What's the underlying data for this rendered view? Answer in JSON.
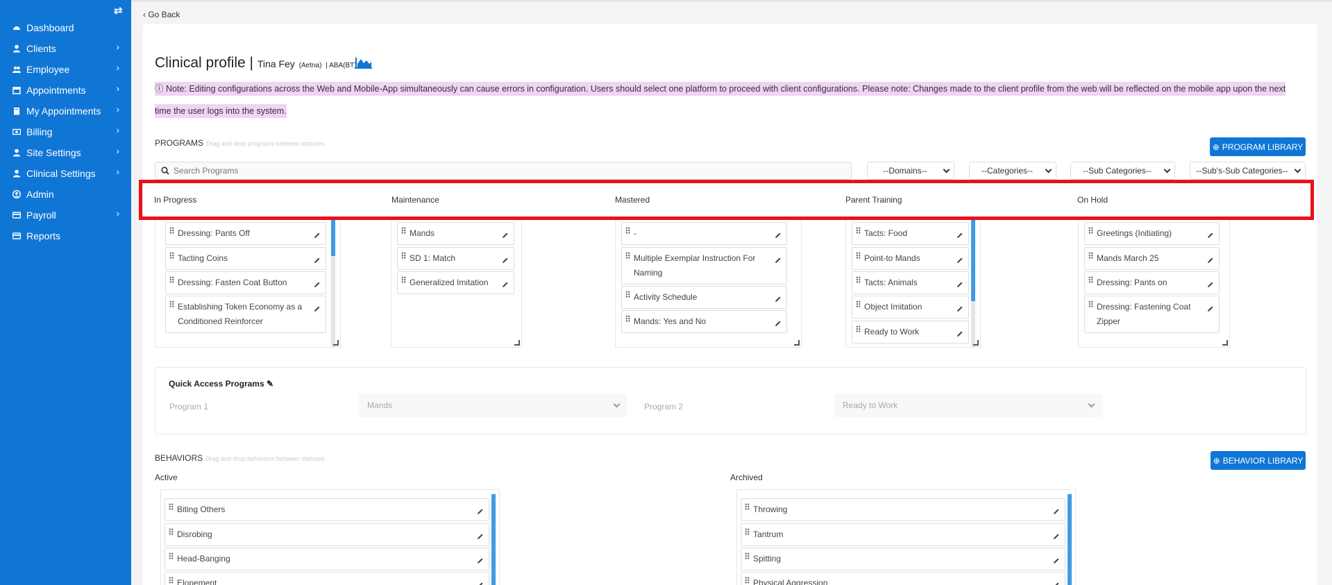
{
  "sidebar": {
    "toggle_icon": "menu-toggle-icon",
    "items": [
      {
        "label": "Dashboard",
        "icon": "dashboard-icon",
        "chevron": false
      },
      {
        "label": "Clients",
        "icon": "user-icon",
        "chevron": true
      },
      {
        "label": "Employee",
        "icon": "users-icon",
        "chevron": true
      },
      {
        "label": "Appointments",
        "icon": "calendar-icon",
        "chevron": true
      },
      {
        "label": "My Appointments",
        "icon": "clipboard-icon",
        "chevron": true
      },
      {
        "label": "Billing",
        "icon": "money-icon",
        "chevron": true
      },
      {
        "label": "Site Settings",
        "icon": "user-icon",
        "chevron": true
      },
      {
        "label": "Clinical Settings",
        "icon": "user-icon",
        "chevron": true
      },
      {
        "label": "Admin",
        "icon": "user-circle-icon",
        "chevron": false
      },
      {
        "label": "Payroll",
        "icon": "credit-card-icon",
        "chevron": true
      },
      {
        "label": "Reports",
        "icon": "credit-card-icon",
        "chevron": false
      }
    ]
  },
  "header": {
    "go_back": "Go Back",
    "title": "Clinical profile |",
    "client_name": "Tina Fey",
    "insurance": "(Aetna)",
    "service": "| ABA(BT)"
  },
  "note": {
    "text": "Note: Editing configurations across the Web and Mobile-App simultaneously can cause errors in configuration. Users should select one platform to proceed with client configurations. Please note: Changes made to the client profile from the web will be reflected on the mobile app upon the next time the user logs into the system."
  },
  "programs": {
    "section_label": "PROGRAMS",
    "hint": "Drag and drop programs between statuses",
    "library_button": "PROGRAM LIBRARY",
    "search_placeholder": "Search Programs",
    "filters": [
      "--Domains--",
      "--Categories--",
      "--Sub Categories--",
      "--Sub's-Sub Categories--"
    ],
    "statuses": [
      {
        "label": "In Progress",
        "items": [
          "Dressing: Pants Off",
          "Tacting Coins",
          "Dressing: Fasten Coat Button",
          "Establishing Token Economy as a Conditioned Reinforcer"
        ]
      },
      {
        "label": "Maintenance",
        "items": [
          "Mands",
          "SD 1: Match",
          "Generalized Imitation"
        ]
      },
      {
        "label": "Mastered",
        "items": [
          "-",
          "Multiple Exemplar Instruction For Naming",
          "Activity Schedule",
          "Mands: Yes and No"
        ]
      },
      {
        "label": "Parent Training",
        "items": [
          "Tacts: Food",
          "Point-to Mands",
          "Tacts: Animals",
          "Object Imitation",
          "Ready to Work"
        ]
      },
      {
        "label": "On Hold",
        "items": [
          "Greetings (Initiating)",
          "Mands March 25",
          "Dressing: Pants on",
          "Dressing: Fastening Coat Zipper"
        ]
      }
    ]
  },
  "quick_access": {
    "title": "Quick Access Programs",
    "program1_label": "Program 1",
    "program1_value": "Mands",
    "program2_label": "Program 2",
    "program2_value": "Ready to Work"
  },
  "behaviors": {
    "section_label": "BEHAVIORS",
    "hint": "Drag and drop behaviors between statuses",
    "library_button": "BEHAVIOR LIBRARY",
    "active_label": "Active",
    "archived_label": "Archived",
    "active_items": [
      "Biting Others",
      "Disrobing",
      "Head-Banging",
      "Elopement"
    ],
    "archived_items": [
      "Throwing",
      "Tantrum",
      "Spitting",
      "Physical Aggression"
    ]
  },
  "colors": {
    "accent": "#1076d6",
    "highlight_border": "#e8121c",
    "note_bg": "#f0d4f4"
  }
}
